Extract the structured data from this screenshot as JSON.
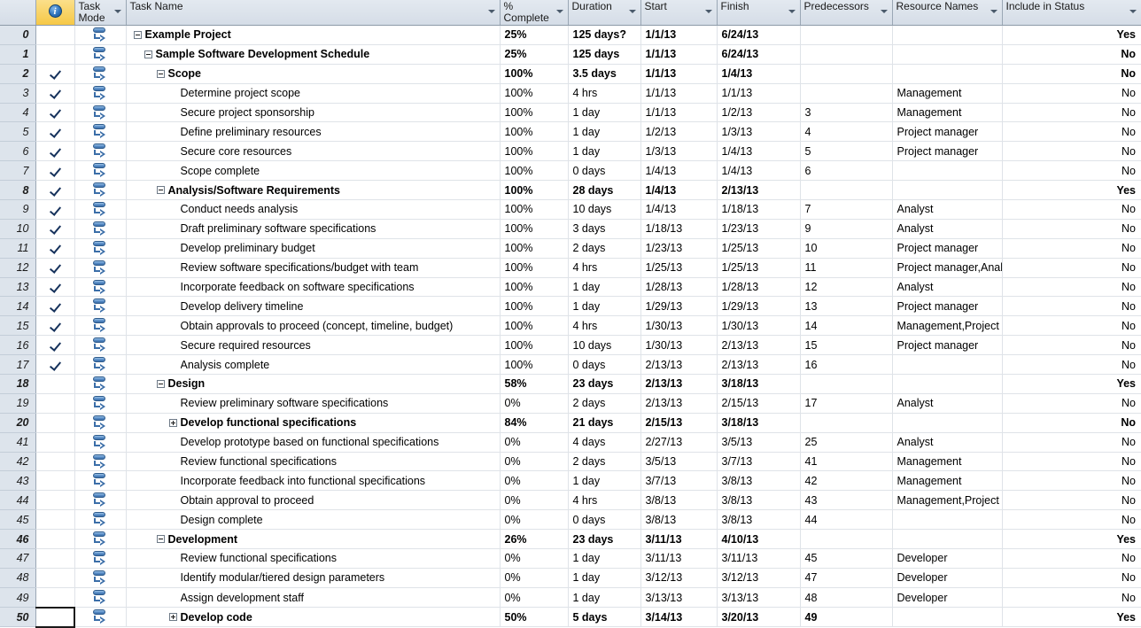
{
  "app": "Microsoft Project - Gantt Chart Entry Table",
  "colors": {
    "header_bg": "#dbe2ea",
    "info_header_bg": "#f6c846",
    "rownum_bg": "#dde4ec",
    "gridline": "#dfe3e8",
    "accent_blue": "#3b6ea8"
  },
  "columns": [
    {
      "key": "rownum",
      "label": "",
      "dropdown": false
    },
    {
      "key": "ind",
      "label": "",
      "dropdown": false,
      "icon": "info-icon"
    },
    {
      "key": "mode",
      "label": "Task Mode",
      "dropdown": true
    },
    {
      "key": "name",
      "label": "Task Name",
      "dropdown": true
    },
    {
      "key": "pct",
      "label": "% Complete",
      "dropdown": true
    },
    {
      "key": "dur",
      "label": "Duration",
      "dropdown": true
    },
    {
      "key": "start",
      "label": "Start",
      "dropdown": true
    },
    {
      "key": "finish",
      "label": "Finish",
      "dropdown": true
    },
    {
      "key": "pred",
      "label": "Predecessors",
      "dropdown": true
    },
    {
      "key": "res",
      "label": "Resource Names",
      "dropdown": true
    },
    {
      "key": "incl",
      "label": "Include in Status",
      "dropdown": true
    }
  ],
  "rows": [
    {
      "rownum": "0",
      "indent": 0,
      "twisty": "minus",
      "bold": true,
      "check": false,
      "mode": "auto-schedule-icon",
      "name": "Example Project",
      "pct": "25%",
      "dur": "125 days?",
      "start": "1/1/13",
      "finish": "6/24/13",
      "pred": "",
      "res": "",
      "incl": "Yes"
    },
    {
      "rownum": "1",
      "indent": 1,
      "twisty": "minus",
      "bold": true,
      "check": false,
      "mode": "auto-schedule-icon",
      "name": "Sample Software Development Schedule",
      "pct": "25%",
      "dur": "125 days",
      "start": "1/1/13",
      "finish": "6/24/13",
      "pred": "",
      "res": "",
      "incl": "No"
    },
    {
      "rownum": "2",
      "indent": 2,
      "twisty": "minus",
      "bold": true,
      "check": true,
      "mode": "auto-schedule-icon",
      "name": "Scope",
      "pct": "100%",
      "dur": "3.5 days",
      "start": "1/1/13",
      "finish": "1/4/13",
      "pred": "",
      "res": "",
      "incl": "No"
    },
    {
      "rownum": "3",
      "indent": 3,
      "twisty": "none",
      "bold": false,
      "check": true,
      "mode": "auto-schedule-icon",
      "name": "Determine project scope",
      "pct": "100%",
      "dur": "4 hrs",
      "start": "1/1/13",
      "finish": "1/1/13",
      "pred": "",
      "res": "Management",
      "incl": "No"
    },
    {
      "rownum": "4",
      "indent": 3,
      "twisty": "none",
      "bold": false,
      "check": true,
      "mode": "auto-schedule-icon",
      "name": "Secure project sponsorship",
      "pct": "100%",
      "dur": "1 day",
      "start": "1/1/13",
      "finish": "1/2/13",
      "pred": "3",
      "res": "Management",
      "incl": "No"
    },
    {
      "rownum": "5",
      "indent": 3,
      "twisty": "none",
      "bold": false,
      "check": true,
      "mode": "auto-schedule-icon",
      "name": "Define preliminary resources",
      "pct": "100%",
      "dur": "1 day",
      "start": "1/2/13",
      "finish": "1/3/13",
      "pred": "4",
      "res": "Project manager",
      "incl": "No"
    },
    {
      "rownum": "6",
      "indent": 3,
      "twisty": "none",
      "bold": false,
      "check": true,
      "mode": "auto-schedule-icon",
      "name": "Secure core resources",
      "pct": "100%",
      "dur": "1 day",
      "start": "1/3/13",
      "finish": "1/4/13",
      "pred": "5",
      "res": "Project manager",
      "incl": "No"
    },
    {
      "rownum": "7",
      "indent": 3,
      "twisty": "none",
      "bold": false,
      "check": true,
      "mode": "auto-schedule-icon",
      "name": "Scope complete",
      "pct": "100%",
      "dur": "0 days",
      "start": "1/4/13",
      "finish": "1/4/13",
      "pred": "6",
      "res": "",
      "incl": "No"
    },
    {
      "rownum": "8",
      "indent": 2,
      "twisty": "minus",
      "bold": true,
      "check": true,
      "mode": "auto-schedule-icon",
      "name": "Analysis/Software Requirements",
      "pct": "100%",
      "dur": "28 days",
      "start": "1/4/13",
      "finish": "2/13/13",
      "pred": "",
      "res": "",
      "incl": "Yes"
    },
    {
      "rownum": "9",
      "indent": 3,
      "twisty": "none",
      "bold": false,
      "check": true,
      "mode": "auto-schedule-icon",
      "name": "Conduct needs analysis",
      "pct": "100%",
      "dur": "10 days",
      "start": "1/4/13",
      "finish": "1/18/13",
      "pred": "7",
      "res": "Analyst",
      "incl": "No"
    },
    {
      "rownum": "10",
      "indent": 3,
      "twisty": "none",
      "bold": false,
      "check": true,
      "mode": "auto-schedule-icon",
      "name": "Draft preliminary software specifications",
      "pct": "100%",
      "dur": "3 days",
      "start": "1/18/13",
      "finish": "1/23/13",
      "pred": "9",
      "res": "Analyst",
      "incl": "No"
    },
    {
      "rownum": "11",
      "indent": 3,
      "twisty": "none",
      "bold": false,
      "check": true,
      "mode": "auto-schedule-icon",
      "name": "Develop preliminary budget",
      "pct": "100%",
      "dur": "2 days",
      "start": "1/23/13",
      "finish": "1/25/13",
      "pred": "10",
      "res": "Project manager",
      "incl": "No"
    },
    {
      "rownum": "12",
      "indent": 3,
      "twisty": "none",
      "bold": false,
      "check": true,
      "mode": "auto-schedule-icon",
      "name": "Review software specifications/budget with team",
      "pct": "100%",
      "dur": "4 hrs",
      "start": "1/25/13",
      "finish": "1/25/13",
      "pred": "11",
      "res": "Project manager,Analyst",
      "incl": "No"
    },
    {
      "rownum": "13",
      "indent": 3,
      "twisty": "none",
      "bold": false,
      "check": true,
      "mode": "auto-schedule-icon",
      "name": "Incorporate feedback on software specifications",
      "pct": "100%",
      "dur": "1 day",
      "start": "1/28/13",
      "finish": "1/28/13",
      "pred": "12",
      "res": "Analyst",
      "incl": "No"
    },
    {
      "rownum": "14",
      "indent": 3,
      "twisty": "none",
      "bold": false,
      "check": true,
      "mode": "auto-schedule-icon",
      "name": "Develop delivery timeline",
      "pct": "100%",
      "dur": "1 day",
      "start": "1/29/13",
      "finish": "1/29/13",
      "pred": "13",
      "res": "Project manager",
      "incl": "No"
    },
    {
      "rownum": "15",
      "indent": 3,
      "twisty": "none",
      "bold": false,
      "check": true,
      "mode": "auto-schedule-icon",
      "name": "Obtain approvals to proceed (concept, timeline, budget)",
      "pct": "100%",
      "dur": "4 hrs",
      "start": "1/30/13",
      "finish": "1/30/13",
      "pred": "14",
      "res": "Management,Project manager",
      "incl": "No"
    },
    {
      "rownum": "16",
      "indent": 3,
      "twisty": "none",
      "bold": false,
      "check": true,
      "mode": "auto-schedule-icon",
      "name": "Secure required resources",
      "pct": "100%",
      "dur": "10 days",
      "start": "1/30/13",
      "finish": "2/13/13",
      "pred": "15",
      "res": "Project manager",
      "incl": "No"
    },
    {
      "rownum": "17",
      "indent": 3,
      "twisty": "none",
      "bold": false,
      "check": true,
      "mode": "auto-schedule-icon",
      "name": "Analysis complete",
      "pct": "100%",
      "dur": "0 days",
      "start": "2/13/13",
      "finish": "2/13/13",
      "pred": "16",
      "res": "",
      "incl": "No"
    },
    {
      "rownum": "18",
      "indent": 2,
      "twisty": "minus",
      "bold": true,
      "check": false,
      "mode": "auto-schedule-icon",
      "name": "Design",
      "pct": "58%",
      "dur": "23 days",
      "start": "2/13/13",
      "finish": "3/18/13",
      "pred": "",
      "res": "",
      "incl": "Yes"
    },
    {
      "rownum": "19",
      "indent": 3,
      "twisty": "none",
      "bold": false,
      "check": false,
      "mode": "auto-schedule-icon",
      "name": "Review preliminary software specifications",
      "pct": "0%",
      "dur": "2 days",
      "start": "2/13/13",
      "finish": "2/15/13",
      "pred": "17",
      "res": "Analyst",
      "incl": "No"
    },
    {
      "rownum": "20",
      "indent": 3,
      "twisty": "plus",
      "bold": true,
      "check": false,
      "mode": "auto-schedule-icon",
      "name": "Develop functional specifications",
      "pct": "84%",
      "dur": "21 days",
      "start": "2/15/13",
      "finish": "3/18/13",
      "pred": "",
      "res": "",
      "incl": "No"
    },
    {
      "rownum": "41",
      "indent": 3,
      "twisty": "none",
      "bold": false,
      "check": false,
      "mode": "auto-schedule-icon",
      "name": "Develop prototype based on functional specifications",
      "pct": "0%",
      "dur": "4 days",
      "start": "2/27/13",
      "finish": "3/5/13",
      "pred": "25",
      "res": "Analyst",
      "incl": "No"
    },
    {
      "rownum": "42",
      "indent": 3,
      "twisty": "none",
      "bold": false,
      "check": false,
      "mode": "auto-schedule-icon",
      "name": "Review functional specifications",
      "pct": "0%",
      "dur": "2 days",
      "start": "3/5/13",
      "finish": "3/7/13",
      "pred": "41",
      "res": "Management",
      "incl": "No"
    },
    {
      "rownum": "43",
      "indent": 3,
      "twisty": "none",
      "bold": false,
      "check": false,
      "mode": "auto-schedule-icon",
      "name": "Incorporate feedback into functional specifications",
      "pct": "0%",
      "dur": "1 day",
      "start": "3/7/13",
      "finish": "3/8/13",
      "pred": "42",
      "res": "Management",
      "incl": "No"
    },
    {
      "rownum": "44",
      "indent": 3,
      "twisty": "none",
      "bold": false,
      "check": false,
      "mode": "auto-schedule-icon",
      "name": "Obtain approval to proceed",
      "pct": "0%",
      "dur": "4 hrs",
      "start": "3/8/13",
      "finish": "3/8/13",
      "pred": "43",
      "res": "Management,Project manager",
      "incl": "No"
    },
    {
      "rownum": "45",
      "indent": 3,
      "twisty": "none",
      "bold": false,
      "check": false,
      "mode": "auto-schedule-icon",
      "name": "Design complete",
      "pct": "0%",
      "dur": "0 days",
      "start": "3/8/13",
      "finish": "3/8/13",
      "pred": "44",
      "res": "",
      "incl": "No"
    },
    {
      "rownum": "46",
      "indent": 2,
      "twisty": "minus",
      "bold": true,
      "check": false,
      "mode": "auto-schedule-icon",
      "name": "Development",
      "pct": "26%",
      "dur": "23 days",
      "start": "3/11/13",
      "finish": "4/10/13",
      "pred": "",
      "res": "",
      "incl": "Yes"
    },
    {
      "rownum": "47",
      "indent": 3,
      "twisty": "none",
      "bold": false,
      "check": false,
      "mode": "auto-schedule-icon",
      "name": "Review functional specifications",
      "pct": "0%",
      "dur": "1 day",
      "start": "3/11/13",
      "finish": "3/11/13",
      "pred": "45",
      "res": "Developer",
      "incl": "No"
    },
    {
      "rownum": "48",
      "indent": 3,
      "twisty": "none",
      "bold": false,
      "check": false,
      "mode": "auto-schedule-icon",
      "name": "Identify modular/tiered design parameters",
      "pct": "0%",
      "dur": "1 day",
      "start": "3/12/13",
      "finish": "3/12/13",
      "pred": "47",
      "res": "Developer",
      "incl": "No"
    },
    {
      "rownum": "49",
      "indent": 3,
      "twisty": "none",
      "bold": false,
      "check": false,
      "mode": "auto-schedule-icon",
      "name": "Assign development staff",
      "pct": "0%",
      "dur": "1 day",
      "start": "3/13/13",
      "finish": "3/13/13",
      "pred": "48",
      "res": "Developer",
      "incl": "No"
    },
    {
      "rownum": "50",
      "indent": 3,
      "twisty": "plus",
      "bold": true,
      "check": false,
      "mode": "auto-schedule-icon",
      "name": "Develop code",
      "pct": "50%",
      "dur": "5 days",
      "start": "3/14/13",
      "finish": "3/20/13",
      "pred": "49",
      "res": "",
      "incl": "Yes",
      "selected": true
    }
  ]
}
